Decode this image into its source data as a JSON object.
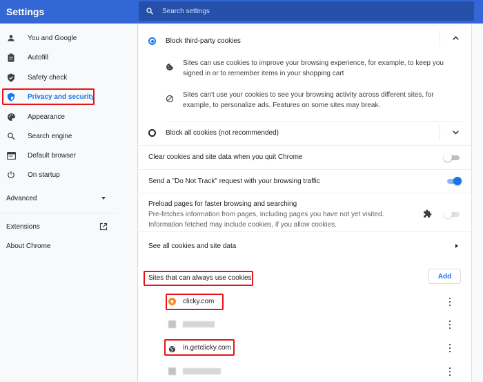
{
  "app": {
    "title": "Settings"
  },
  "search": {
    "placeholder": "Search settings",
    "icon": "search-icon"
  },
  "sidebar": {
    "items": [
      {
        "label": "You and Google",
        "icon": "person-icon"
      },
      {
        "label": "Autofill",
        "icon": "clipboard-icon"
      },
      {
        "label": "Safety check",
        "icon": "shield-check-icon"
      },
      {
        "label": "Privacy and security",
        "icon": "shield-icon",
        "active": true
      },
      {
        "label": "Appearance",
        "icon": "palette-icon"
      },
      {
        "label": "Search engine",
        "icon": "search-icon"
      },
      {
        "label": "Default browser",
        "icon": "browser-icon"
      },
      {
        "label": "On startup",
        "icon": "power-icon"
      }
    ],
    "advanced": {
      "label": "Advanced",
      "icon": "caret-down-icon"
    },
    "extensions": {
      "label": "Extensions",
      "icon": "open-in-new-icon"
    },
    "about": {
      "label": "About Chrome"
    }
  },
  "cookies": {
    "block_third_party": {
      "label": "Block third-party cookies",
      "selected": true,
      "expanded": true,
      "details": [
        {
          "icon": "cookie-icon",
          "text": "Sites can use cookies to improve your browsing experience, for example, to keep you signed in or to remember items in your shopping cart"
        },
        {
          "icon": "block-icon",
          "text": "Sites can't use your cookies to see your browsing activity across different sites, for example, to personalize ads. Features on some sites may break."
        }
      ]
    },
    "block_all": {
      "label": "Block all cookies (not recommended)",
      "selected": false,
      "expanded": false
    },
    "clear_on_quit": {
      "label": "Clear cookies and site data when you quit Chrome",
      "enabled": false
    },
    "do_not_track": {
      "label": "Send a \"Do Not Track\" request with your browsing traffic",
      "enabled": true
    },
    "preload": {
      "label": "Preload pages for faster browsing and searching",
      "description": "Pre-fetches information from pages, including pages you have not yet visited. Information fetched may include cookies, if you allow cookies.",
      "enabled": false,
      "extension_controlled": true
    },
    "see_all": {
      "label": "See all cookies and site data"
    },
    "always_allow": {
      "heading": "Sites that can always use cookies",
      "add_label": "Add",
      "sites": [
        {
          "name": "clicky.com",
          "favicon": "clicky-favicon",
          "highlighted": true
        },
        {
          "name": "",
          "favicon": "blurred-favicon",
          "blurred": true
        },
        {
          "name": "in.getclicky.com",
          "favicon": "globe-icon",
          "highlighted": true
        },
        {
          "name": "",
          "favicon": "blurred-favicon",
          "blurred": true
        }
      ]
    }
  },
  "colors": {
    "header": "#3367d6",
    "accent": "#1a73e8",
    "highlight": "#e8131a"
  }
}
